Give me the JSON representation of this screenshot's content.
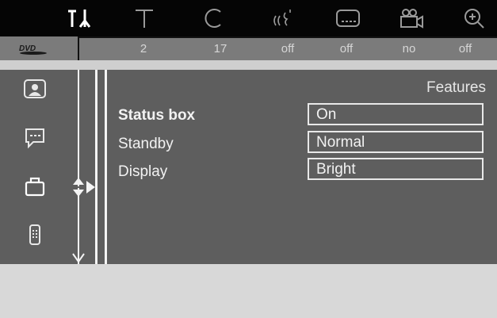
{
  "toolbar": {
    "icons": [
      "settings-icon",
      "text-icon",
      "repeat-icon",
      "audio-icon",
      "subtitle-icon",
      "camera-angle-icon",
      "zoom-icon"
    ],
    "active": "settings-icon"
  },
  "status_bar": {
    "disc": "DVD",
    "values": [
      "2",
      "17",
      "off",
      "off",
      "no",
      "off"
    ]
  },
  "side_menu": {
    "items": [
      "picture-icon",
      "language-icon",
      "features-icon",
      "remote-icon"
    ],
    "selected": "features-icon"
  },
  "content": {
    "title": "Features",
    "rows": [
      {
        "label": "Status box",
        "value": "On",
        "highlighted": true
      },
      {
        "label": "Standby",
        "value": "Normal",
        "highlighted": false
      },
      {
        "label": "Display",
        "value": "Bright",
        "highlighted": false
      }
    ]
  },
  "colors": {
    "background": "#5e5e5e",
    "topbar": "#050505",
    "status": "#7b7b7b"
  }
}
